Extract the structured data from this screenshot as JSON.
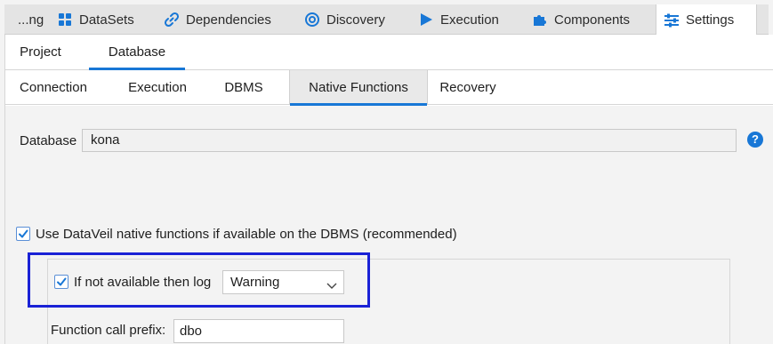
{
  "top_tabs": [
    {
      "label": "...ng",
      "icon": null
    },
    {
      "label": "DataSets",
      "icon": "grid-icon"
    },
    {
      "label": "Dependencies",
      "icon": "link-icon"
    },
    {
      "label": "Discovery",
      "icon": "target-icon"
    },
    {
      "label": "Execution",
      "icon": "play-icon"
    },
    {
      "label": "Components",
      "icon": "puzzle-icon"
    },
    {
      "label": "Settings",
      "icon": "sliders-icon"
    }
  ],
  "active_top_tab": "Settings",
  "sub_tabs": [
    "Project",
    "Database"
  ],
  "active_sub_tab": "Database",
  "db_tabs": [
    "Connection",
    "Execution",
    "DBMS",
    "Native Functions",
    "Recovery"
  ],
  "active_db_tab": "Native Functions",
  "form": {
    "database_label": "Database",
    "database_value": "kona",
    "help": "?",
    "use_native_label": "Use DataVeil native functions if available on the DBMS (recommended)",
    "use_native_checked": true,
    "if_not_available_label": "If not available then log",
    "if_not_available_checked": true,
    "log_level": "Warning",
    "prefix_label": "Function call prefix:",
    "prefix_value": "dbo"
  },
  "colors": {
    "accent": "#1877d6",
    "highlight_box": "#1a22d6"
  }
}
